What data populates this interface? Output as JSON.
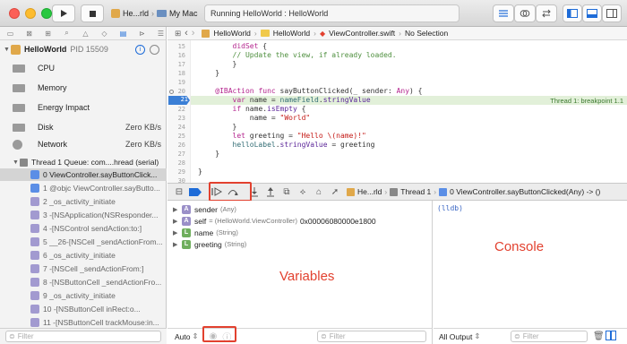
{
  "toolbar": {
    "scheme_project": "He...rld",
    "scheme_device": "My Mac",
    "activity_text": "Running HelloWorld : HelloWorld"
  },
  "navigator": {
    "process_name": "HelloWorld",
    "process_pid": "PID 15509",
    "gauges": [
      {
        "label": "CPU",
        "value": ""
      },
      {
        "label": "Memory",
        "value": ""
      },
      {
        "label": "Energy Impact",
        "value": ""
      },
      {
        "label": "Disk",
        "value": "Zero KB/s"
      },
      {
        "label": "Network",
        "value": "Zero KB/s"
      }
    ],
    "thread_label": "Thread 1 Queue: com....hread (serial)",
    "frames": [
      "0 ViewController.sayButtonClick...",
      "1 @objc ViewController.sayButto...",
      "2 _os_activity_initiate",
      "3 -[NSApplication(NSResponder...",
      "4 -[NSControl sendAction:to:]",
      "5 __26-[NSCell _sendActionFrom...",
      "6 _os_activity_initiate",
      "7 -[NSCell _sendActionFrom:]",
      "8 -[NSButtonCell _sendActionFro...",
      "9 _os_activity_initiate",
      "10 -[NSButtonCell inRect:o...",
      "11 -[NSButtonCell trackMouse:in..."
    ],
    "filter_placeholder": "Filter"
  },
  "jumpbar": {
    "crumbs": [
      "HelloWorld",
      "HelloWorld",
      "ViewController.swift",
      "No Selection"
    ]
  },
  "editor": {
    "line_numbers": [
      "15",
      "16",
      "17",
      "18",
      "19",
      "20",
      "21",
      "22",
      "23",
      "24",
      "25",
      "26",
      "27",
      "28",
      "29",
      "30"
    ],
    "breakpoint_annotation": "Thread 1: breakpoint 1.1"
  },
  "debugbar": {
    "crumbs": [
      "He...rld",
      "Thread 1",
      "0 ViewController.sayButtonClicked(Any) -> ()"
    ]
  },
  "variables": {
    "rows": [
      {
        "badge": "A",
        "name": "sender",
        "type": "(Any)",
        "value": ""
      },
      {
        "badge": "A",
        "name": "self",
        "type": "= (HelloWorld.ViewController)",
        "value": "0x00006080000e1800"
      },
      {
        "badge": "L",
        "name": "name",
        "type": "(String)",
        "value": ""
      },
      {
        "badge": "L",
        "name": "greeting",
        "type": "(String)",
        "value": ""
      }
    ],
    "overlay_label": "Variables",
    "scope_select": "Auto",
    "filter_placeholder": "Filter"
  },
  "console": {
    "prompt": "(lldb)",
    "overlay_label": "Console",
    "output_select": "All Output",
    "filter_placeholder": "Filter"
  },
  "colors": {
    "annotation_red": "#e2412f",
    "breakpoint_blue": "#3b7fd6",
    "current_line": "#e2f0d9"
  }
}
